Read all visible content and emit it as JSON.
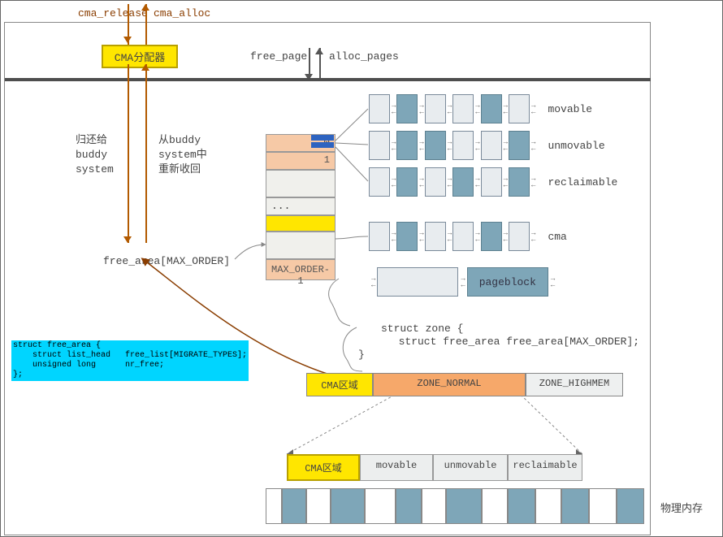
{
  "top": {
    "cma_release": "cma_release",
    "cma_alloc": "cma_alloc",
    "cma_box": "CMA分配器",
    "free_page": "free_page",
    "alloc_pages": "alloc_pages"
  },
  "mid": {
    "return_text": "归还给\nbuddy\nsystem",
    "retrieve_text": "从buddy\nsystem中\n重新收回",
    "free_area_label": "free_area[MAX_ORDER]",
    "fa": {
      "c0": "0",
      "c1": "1",
      "dots": "...",
      "last": "MAX_ORDER-1"
    }
  },
  "rows": {
    "movable": "movable",
    "unmovable": "unmovable",
    "reclaimable": "reclaimable",
    "cma": "cma",
    "pageblock": "pageblock"
  },
  "zone": {
    "open": "struct zone {",
    "field": "  struct free_area free_area[MAX_ORDER];",
    "close": "}"
  },
  "note": {
    "t": "struct free_area {\n    struct list_head   free_list[MIGRATE_TYPES];\n    unsigned long      nr_free;\n};"
  },
  "bar": {
    "cma": "CMA区域",
    "zn": "ZONE_NORMAL",
    "zh": "ZONE_HIGHMEM"
  },
  "mig": {
    "cma": "CMA区域",
    "mov": "movable",
    "unm": "unmovable",
    "rec": "reclaimable"
  },
  "pmem_label": "物理内存"
}
